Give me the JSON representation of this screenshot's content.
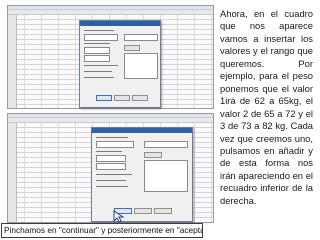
{
  "explanation": "Ahora, en el cuadro que nos aparece vamos a insertar los valores y el rango que queremos. Por ejemplo, para el peso ponemos que el valor 1irá de 62 a 65kg, el valor 2 de 65 a 72 y el 3 de 73 a 82 kg. Cada vez que creemos uno, pulsamos en añadir y de esta forma nos irán apareciendo en el recuadro inferior de la derecha.",
  "caption": "Pinchamos en \"continuar\" y posteriormente en \"aceptar\"",
  "colors": {
    "accent": "#2f5fa5",
    "pointer": "#1f3f7f"
  },
  "icons": {
    "pointer": "arrow-cursor-icon"
  }
}
